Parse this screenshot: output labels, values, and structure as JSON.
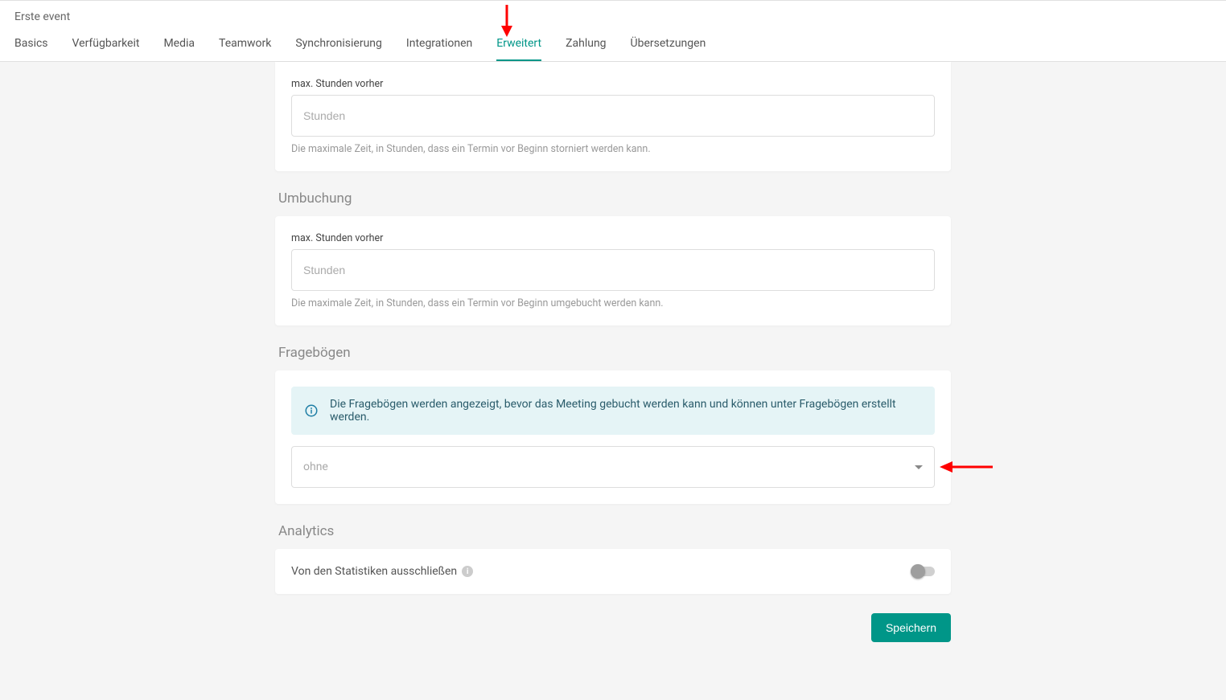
{
  "header": {
    "title": "Erste event",
    "tabs": [
      {
        "label": "Basics",
        "key": "basics"
      },
      {
        "label": "Verfügbarkeit",
        "key": "availability"
      },
      {
        "label": "Media",
        "key": "media"
      },
      {
        "label": "Teamwork",
        "key": "teamwork"
      },
      {
        "label": "Synchronisierung",
        "key": "sync"
      },
      {
        "label": "Integrationen",
        "key": "integrations"
      },
      {
        "label": "Erweitert",
        "key": "advanced",
        "active": true
      },
      {
        "label": "Zahlung",
        "key": "payment"
      },
      {
        "label": "Übersetzungen",
        "key": "translations"
      }
    ]
  },
  "sections": {
    "cancellation": {
      "field_label": "max. Stunden vorher",
      "placeholder": "Stunden",
      "helper": "Die maximale Zeit, in Stunden, dass ein Termin vor Beginn storniert werden kann."
    },
    "rebooking": {
      "title": "Umbuchung",
      "field_label": "max. Stunden vorher",
      "placeholder": "Stunden",
      "helper": "Die maximale Zeit, in Stunden, dass ein Termin vor Beginn umgebucht werden kann."
    },
    "questionnaires": {
      "title": "Fragebögen",
      "info": "Die Fragebögen werden angezeigt, bevor das Meeting gebucht werden kann und können unter Fragebögen erstellt werden.",
      "select_value": "ohne"
    },
    "analytics": {
      "title": "Analytics",
      "exclude_label": "Von den Statistiken ausschließen",
      "exclude_on": false
    }
  },
  "actions": {
    "save": "Speichern"
  }
}
